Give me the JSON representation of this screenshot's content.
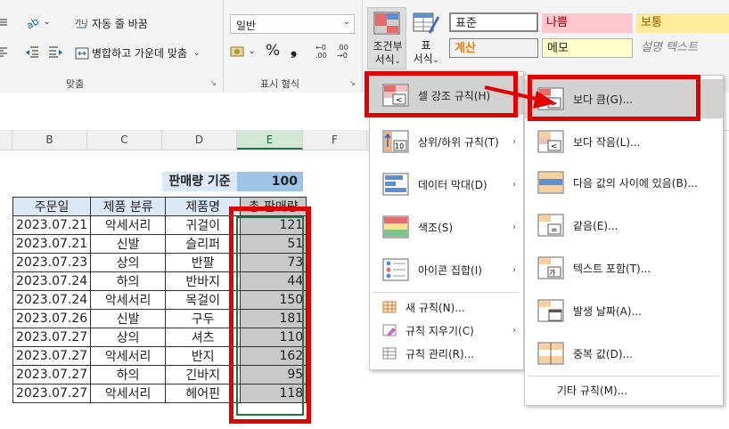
{
  "ribbon": {
    "wrap_text": "자동 줄 바꿈",
    "merge_center": "병합하고 가운데 맞춤",
    "alignment_group": "맞춤",
    "number_format_value": "일반",
    "number_group": "표시 형식",
    "percent_symbol": "%",
    "comma_symbol": "❟",
    "conditional_format_line1": "조건부",
    "conditional_format_line2": "서식",
    "format_as_table_line1": "표",
    "format_as_table_line2": "서식",
    "styles": {
      "normal": "표준",
      "bad": "나쁨",
      "neutral": "보통",
      "calculation": "계산",
      "note": "메모",
      "explanatory": "설명 텍스트"
    },
    "colors": {
      "bad_bg": "#ffc7ce",
      "bad_fg": "#9c0006",
      "neutral_bg": "#ffeb9c",
      "neutral_fg": "#9c5700",
      "calc_fg": "#fa7d00"
    }
  },
  "sheet": {
    "columns": [
      "B",
      "C",
      "D",
      "E",
      "F"
    ],
    "selected_column": "E",
    "criteria_label": "판매량 기준",
    "criteria_value": "100",
    "headers": [
      "주문일",
      "제품 분류",
      "제품명",
      "총 판매량"
    ],
    "rows": [
      [
        "2023.07.21",
        "악세서리",
        "귀걸이",
        "121"
      ],
      [
        "2023.07.21",
        "신발",
        "슬리퍼",
        "51"
      ],
      [
        "2023.07.23",
        "상의",
        "반팔",
        "73"
      ],
      [
        "2023.07.24",
        "하의",
        "반바지",
        "44"
      ],
      [
        "2023.07.24",
        "악세서리",
        "목걸이",
        "150"
      ],
      [
        "2023.07.26",
        "신발",
        "구두",
        "181"
      ],
      [
        "2023.07.27",
        "상의",
        "셔츠",
        "110"
      ],
      [
        "2023.07.27",
        "악세서리",
        "반지",
        "162"
      ],
      [
        "2023.07.27",
        "하의",
        "긴바지",
        "95"
      ],
      [
        "2023.07.27",
        "악세서리",
        "헤어핀",
        "118"
      ]
    ]
  },
  "cf_menu": {
    "items": [
      {
        "label": "셀 강조 규칙(H)",
        "has_submenu": true
      },
      {
        "label": "상위/하위 규칙(T)",
        "has_submenu": true
      },
      {
        "label": "데이터 막대(D)",
        "has_submenu": true
      },
      {
        "label": "색조(S)",
        "has_submenu": true
      },
      {
        "label": "아이콘 집합(I)",
        "has_submenu": true
      }
    ],
    "small_items": [
      {
        "label": "새 규칙(N)..."
      },
      {
        "label": "규칙 지우기(C)",
        "has_submenu": true
      },
      {
        "label": "규칙 관리(R)..."
      }
    ],
    "arrow": "›"
  },
  "highlight_submenu": {
    "items": [
      {
        "label": "보다 큼(G)..."
      },
      {
        "label": "보다 작음(L)..."
      },
      {
        "label": "다음 값의 사이에 있음(B)..."
      },
      {
        "label": "같음(E)..."
      },
      {
        "label": "텍스트 포함(T)..."
      },
      {
        "label": "발생 날짜(A)..."
      },
      {
        "label": "중복 값(D)..."
      }
    ],
    "more_rules": "기타 규칙(M)..."
  },
  "annotation_color": "#e00000"
}
